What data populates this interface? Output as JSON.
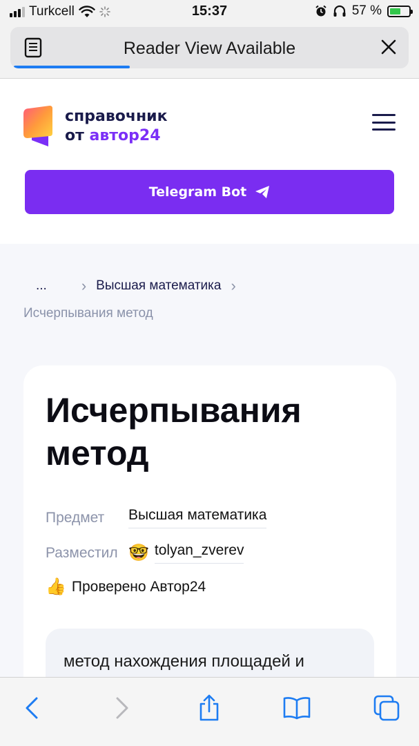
{
  "status_bar": {
    "carrier": "Turkcell",
    "time": "15:37",
    "battery_percent_label": "57 %",
    "battery_level": 0.57
  },
  "reader": {
    "label": "Reader View Available"
  },
  "header": {
    "brand_line1": "справочник",
    "brand_line2_prefix": "от ",
    "brand_line2_accent": "автор24",
    "telegram_button": "Telegram Bot"
  },
  "breadcrumbs": {
    "ellipsis": "...",
    "separator": "›",
    "parent": "Высшая математика",
    "current": "Исчерпывания метод"
  },
  "article": {
    "title": "Исчерпывания метод",
    "subject_label": "Предмет",
    "subject_value": "Высшая математика",
    "author_label": "Разместил",
    "author_emoji": "🤓",
    "author_value": "tolyan_zverev",
    "verified_emoji": "👍",
    "verified_text": "Проверено Автор24",
    "definition": "метод нахождения площадей и объемов в древней математике"
  },
  "colors": {
    "accent": "#7a2df1",
    "brand_dark": "#1a1b4b",
    "ios_blue": "#1d7cf2"
  },
  "toolbar_icons": [
    "back-icon",
    "forward-icon",
    "share-icon",
    "bookmarks-icon",
    "tabs-icon"
  ]
}
